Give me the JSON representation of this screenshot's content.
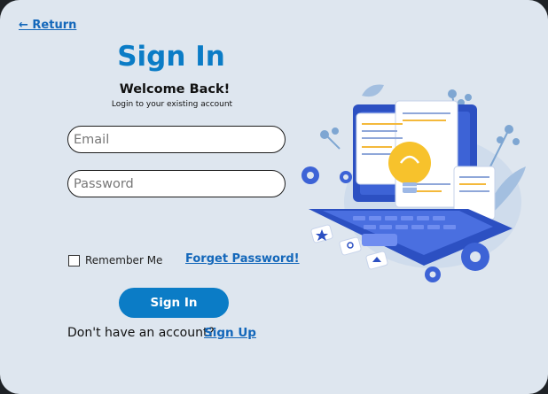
{
  "nav": {
    "return_label": "← Return"
  },
  "form": {
    "title": "Sign In",
    "welcome": "Welcome Back!",
    "subtitle": "Login to your existing account",
    "email_placeholder": "Email",
    "password_placeholder": "Password",
    "remember_label": "Remember Me",
    "forgot_label": "Forget Password!",
    "submit_label": "Sign In",
    "no_account_text": "Don't have an account?",
    "signup_label": "Sign Up"
  },
  "colors": {
    "background": "#dee6ef",
    "accent": "#0b7cc6",
    "link": "#1367ba"
  },
  "illustration": {
    "icon": "laptop-lightbulb-illustration"
  }
}
